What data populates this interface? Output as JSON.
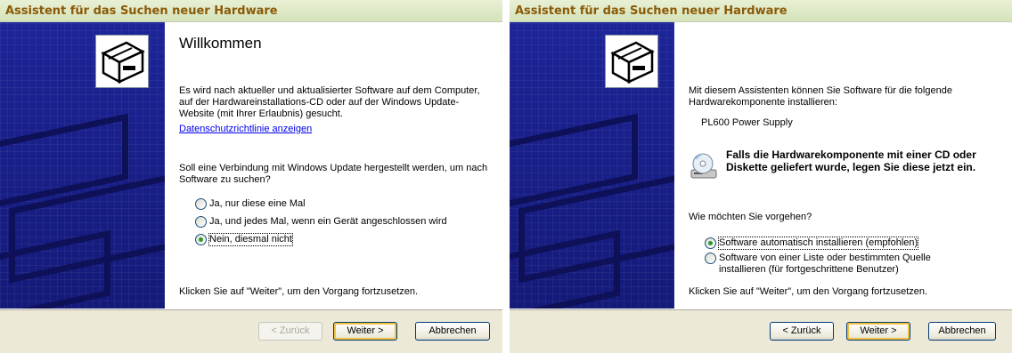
{
  "window1": {
    "title": "Assistent für das Suchen neuer Hardware",
    "heading": "Willkommen",
    "intro": "Es wird nach aktueller und aktualisierter Software auf dem Computer, auf der Hardwareinstallations-CD oder auf der Windows Update-Website (mit Ihrer Erlaubnis) gesucht.",
    "privacy_link": "Datenschutzrichtlinie anzeigen",
    "question": "Soll eine Verbindung mit Windows Update hergestellt werden, um nach Software zu suchen?",
    "options": [
      {
        "label": "Ja, nur diese eine Mal",
        "selected": false
      },
      {
        "label": "Ja, und jedes Mal, wenn ein Gerät angeschlossen wird",
        "selected": false
      },
      {
        "label": "Nein, diesmal nicht",
        "selected": true
      }
    ],
    "continue_text": "Klicken Sie auf \"Weiter\", um den Vorgang fortzusetzen.",
    "buttons": {
      "back": "< Zurück",
      "next": "Weiter >",
      "cancel": "Abbrechen"
    },
    "icon": "hardware-icon"
  },
  "window2": {
    "title": "Assistent für das Suchen neuer Hardware",
    "intro": "Mit diesem Assistenten können Sie Software für die folgende Hardwarekomponente installieren:",
    "device_name": "PL600 Power Supply",
    "cd_notice": "Falls die Hardwarekomponente mit einer CD oder Diskette geliefert wurde, legen Sie diese jetzt ein.",
    "question": "Wie möchten Sie vorgehen?",
    "options": [
      {
        "label": "Software automatisch installieren (empfohlen)",
        "selected": true
      },
      {
        "label": "Software von einer Liste oder bestimmten Quelle installieren (für fortgeschrittene Benutzer)",
        "selected": false
      }
    ],
    "continue_text": "Klicken Sie auf \"Weiter\", um den Vorgang fortzusetzen.",
    "buttons": {
      "back": "< Zurück",
      "next": "Weiter >",
      "cancel": "Abbrechen"
    },
    "icons": [
      "hardware-icon",
      "cd-drive-icon"
    ]
  },
  "colors": {
    "sidebar": "#1a1f8a",
    "title_text": "#8a5a08",
    "footer": "#ece9d8",
    "link": "#0000ee"
  }
}
